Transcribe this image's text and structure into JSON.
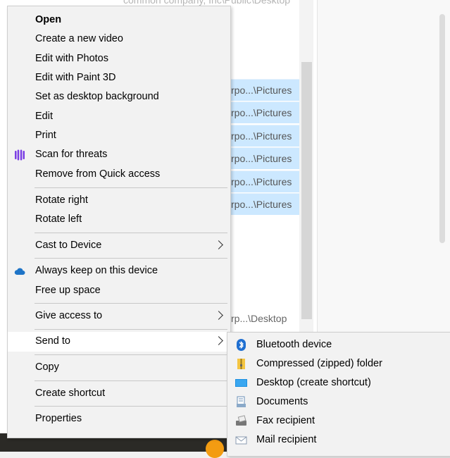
{
  "background": {
    "top_text": "common company, Inc\\Public\\Desktop",
    "selected_rows": [
      "rpo...\\Pictures",
      "rpo...\\Pictures",
      "rpo...\\Pictures",
      "rpo...\\Pictures",
      "rpo...\\Pictures",
      "rpo...\\Pictures"
    ],
    "desktop_row": "rp...\\Desktop"
  },
  "context_menu": {
    "items": {
      "open": "Open",
      "create_video": "Create a new video",
      "edit_photos": "Edit with Photos",
      "edit_paint3d": "Edit with Paint 3D",
      "set_background": "Set as desktop background",
      "edit": "Edit",
      "print": "Print",
      "scan_threats": "Scan for threats",
      "remove_quick": "Remove from Quick access",
      "rotate_right": "Rotate right",
      "rotate_left": "Rotate left",
      "cast": "Cast to Device",
      "keep_device": "Always keep on this device",
      "free_space": "Free up space",
      "give_access": "Give access to",
      "send_to": "Send to",
      "copy": "Copy",
      "create_shortcut": "Create shortcut",
      "properties": "Properties"
    },
    "icons": {
      "scan": "shield-scan-icon",
      "cloud": "cloud-icon"
    },
    "colors": {
      "scan": "#7b3fe4",
      "cloud": "#1e74c7",
      "hover_bg": "#ffffff"
    }
  },
  "send_to_menu": {
    "items": [
      {
        "label": "Bluetooth device",
        "icon": "bluetooth-icon"
      },
      {
        "label": "Compressed (zipped) folder",
        "icon": "zip-folder-icon"
      },
      {
        "label": "Desktop (create shortcut)",
        "icon": "desktop-icon"
      },
      {
        "label": "Documents",
        "icon": "documents-icon"
      },
      {
        "label": "Fax recipient",
        "icon": "fax-icon"
      },
      {
        "label": "Mail recipient",
        "icon": "mail-icon"
      }
    ]
  }
}
